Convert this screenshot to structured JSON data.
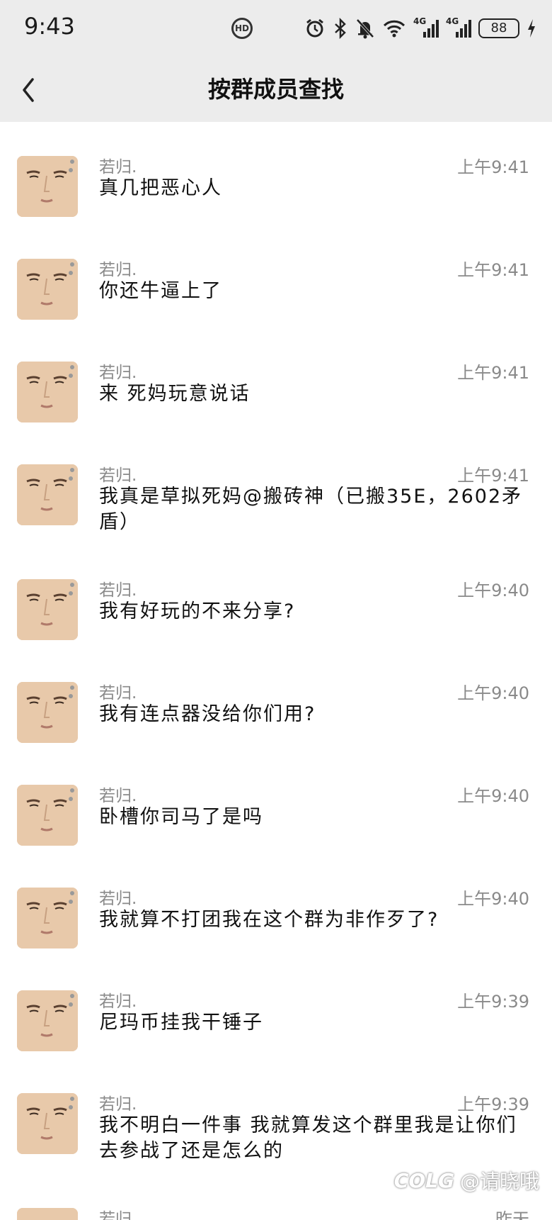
{
  "status_bar": {
    "time": "9:43",
    "hd_label": "HD",
    "battery": "88"
  },
  "header": {
    "title": "按群成员查找"
  },
  "messages": [
    {
      "sender": "若归.",
      "time": "上午9:41",
      "text": "真几把恶心人"
    },
    {
      "sender": "若归.",
      "time": "上午9:41",
      "text": "你还牛逼上了"
    },
    {
      "sender": "若归.",
      "time": "上午9:41",
      "text": "来 死妈玩意说话"
    },
    {
      "sender": "若归.",
      "time": "上午9:41",
      "text": "我真是草拟死妈@搬砖神（已搬35E，2602矛盾）"
    },
    {
      "sender": "若归.",
      "time": "上午9:40",
      "text": "我有好玩的不来分享?"
    },
    {
      "sender": "若归.",
      "time": "上午9:40",
      "text": "我有连点器没给你们用?"
    },
    {
      "sender": "若归.",
      "time": "上午9:40",
      "text": "卧槽你司马了是吗"
    },
    {
      "sender": "若归.",
      "time": "上午9:40",
      "text": "我就算不打团我在这个群为非作歹了?"
    },
    {
      "sender": "若归.",
      "time": "上午9:39",
      "text": "尼玛币挂我干锤子"
    },
    {
      "sender": "若归.",
      "time": "上午9:39",
      "text": "我不明白一件事 我就算发这个群里我是让你们去参战了还是怎么的"
    },
    {
      "sender": "若归.",
      "time": "昨天",
      "text": ""
    }
  ],
  "watermark": {
    "logo": "COLG",
    "handle": "@请晓哦"
  }
}
